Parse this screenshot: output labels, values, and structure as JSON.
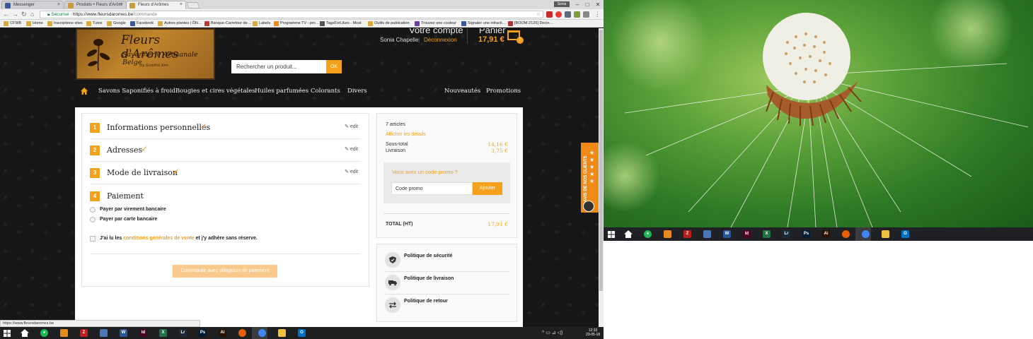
{
  "browser": {
    "tabs": [
      {
        "title": "Messenger",
        "color": "#3b5998"
      },
      {
        "title": "Produits • Fleurs d'Arôm",
        "color": "#c79a3a"
      },
      {
        "title": "Fleurs d'Arômes",
        "color": "#c79a3a"
      }
    ],
    "user": "Sonia",
    "url_secure": "Sécurisé",
    "url_host": "https://www.fleursdaromes.be",
    "url_path": "/commande",
    "bookmarks": [
      "CFWB",
      "Home",
      "Inscriptions sites",
      "Tutos",
      "Google",
      "Facebook",
      "Autres plantes | ÔN…",
      "Banque-Carrefour de…",
      "Labels",
      "Programme TV : pro…",
      "TagsForLikes - Most",
      "Outils de publication",
      "Trouvez une couleur",
      "Signaler une infracti…",
      "[BOOM-2126] Decin…"
    ],
    "status_url": "https://www.fleursdaromes.be"
  },
  "site": {
    "logo": {
      "line1": "Fleurs d'Arômes",
      "line2": "Savonnerie Artisanale Belge",
      "line3": "By Sandra Aro"
    },
    "account": {
      "title": "Votre compte",
      "name": "Sonia Chapelle",
      "separator": "|",
      "logout": "Déconnexion"
    },
    "cart": {
      "title": "Panier",
      "total": "17,91 €",
      "count": "7"
    },
    "search": {
      "placeholder": "Rechercher un produit...",
      "button": "OK"
    },
    "nav": [
      "Savons Saponifiés à froid",
      "Bougies et cires végétales",
      "Huiles parfumées",
      "Colorants",
      "Divers",
      "Nouveautés",
      "Promotions"
    ]
  },
  "checkout": {
    "steps": [
      {
        "num": "1",
        "title": "Informations personnelles",
        "edit": "edit"
      },
      {
        "num": "2",
        "title": "Adresses",
        "edit": "edit"
      },
      {
        "num": "3",
        "title": "Mode de livraison",
        "edit": "edit"
      },
      {
        "num": "4",
        "title": "Paiement"
      }
    ],
    "payment_options": [
      "Payer par virement bancaire",
      "Payer par carte bancaire"
    ],
    "terms_pre": "J'ai lu les",
    "terms_link": "conditions générales de vente",
    "terms_post": "et j'y adhère sans réserve.",
    "order_button": "Commande avec obligation de paiement"
  },
  "summary": {
    "count": "7 articles",
    "details_link": "Afficher les détails",
    "subtotal_label": "Sous-total",
    "subtotal": "14,16 €",
    "shipping_label": "Livraison",
    "shipping": "3,75 €",
    "promo_title": "Vous avez un code promo ?",
    "promo_placeholder": "Code promo",
    "promo_button": "Ajouter",
    "total_label": "TOTAL (HT)",
    "total": "17,91 €"
  },
  "policies": [
    "Politique de sécurité",
    "Politique de livraison",
    "Politique de retour"
  ],
  "reviews_tab": "AVIS DE NOS CLIENTS",
  "taskbar": {
    "time": "12:33",
    "date": "23-05-18",
    "apps": [
      {
        "name": "spotify",
        "color": "#1db954",
        "glyph": "●"
      },
      {
        "name": "app-orange",
        "color": "#e88a1a",
        "glyph": ""
      },
      {
        "name": "filezilla",
        "color": "#bf1e1e",
        "glyph": "Z"
      },
      {
        "name": "app-blue",
        "color": "#4a78b5",
        "glyph": ""
      },
      {
        "name": "word",
        "color": "#2b579a",
        "glyph": "W"
      },
      {
        "name": "indesign",
        "color": "#49021f",
        "glyph": "Id"
      },
      {
        "name": "excel",
        "color": "#217346",
        "glyph": "X"
      },
      {
        "name": "lightroom",
        "color": "#1c2a38",
        "glyph": "Lr"
      },
      {
        "name": "photoshop",
        "color": "#001d34",
        "glyph": "Ps"
      },
      {
        "name": "illustrator",
        "color": "#2b1200",
        "glyph": "Ai"
      },
      {
        "name": "firefox",
        "color": "#e66000",
        "glyph": ""
      },
      {
        "name": "chrome",
        "color": "#4285f4",
        "glyph": ""
      },
      {
        "name": "explorer",
        "color": "#f0c040",
        "glyph": ""
      },
      {
        "name": "outlook",
        "color": "#0072c6",
        "glyph": "O"
      }
    ]
  }
}
